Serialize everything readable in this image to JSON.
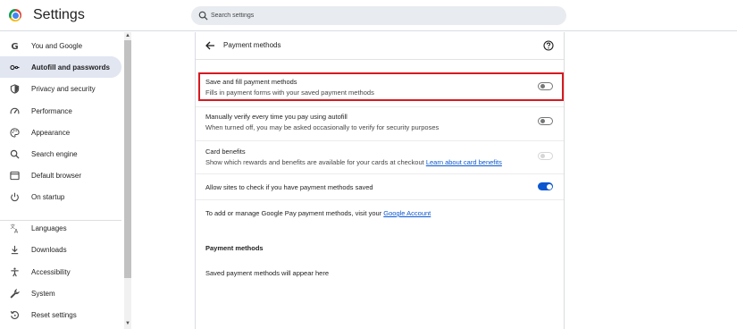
{
  "app": {
    "title": "Settings"
  },
  "search": {
    "placeholder": "Search settings"
  },
  "sidebar": {
    "items": [
      {
        "label": "You and Google",
        "icon": "google-g-icon"
      },
      {
        "label": "Autofill and passwords",
        "icon": "key-icon",
        "active": true
      },
      {
        "label": "Privacy and security",
        "icon": "shield-icon"
      },
      {
        "label": "Performance",
        "icon": "gauge-icon"
      },
      {
        "label": "Appearance",
        "icon": "palette-icon"
      },
      {
        "label": "Search engine",
        "icon": "search-icon"
      },
      {
        "label": "Default browser",
        "icon": "browser-icon"
      },
      {
        "label": "On startup",
        "icon": "power-icon"
      },
      {
        "label": "Languages",
        "icon": "translate-icon"
      },
      {
        "label": "Downloads",
        "icon": "download-icon"
      },
      {
        "label": "Accessibility",
        "icon": "accessibility-icon"
      },
      {
        "label": "System",
        "icon": "wrench-icon"
      },
      {
        "label": "Reset settings",
        "icon": "reset-icon"
      }
    ]
  },
  "panel": {
    "title": "Payment methods",
    "settings": [
      {
        "title": "Save and fill payment methods",
        "desc": "Fills in payment forms with your saved payment methods",
        "state": "off"
      },
      {
        "title": "Manually verify every time you pay using autofill",
        "desc": "When turned off, you may be asked occasionally to verify for security purposes",
        "state": "off"
      },
      {
        "title": "Card benefits",
        "desc": "Show which rewards and benefits are available for your cards at checkout",
        "link": "Learn about card benefits",
        "state": "disabled"
      },
      {
        "title": "Allow sites to check if you have payment methods saved",
        "state": "on"
      }
    ],
    "google_pay": {
      "text": "To add or manage Google Pay payment methods, visit your",
      "link": "Google Account"
    },
    "section_title": "Payment methods",
    "empty_text": "Saved payment methods will appear here"
  },
  "colors": {
    "accent": "#0b57d0",
    "highlight": "#d71920",
    "active_nav_bg": "#e1e6f1"
  }
}
